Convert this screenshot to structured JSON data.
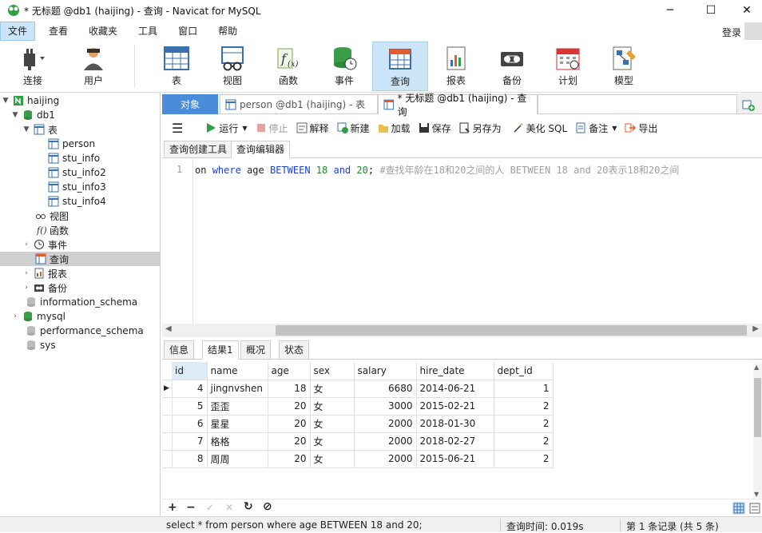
{
  "window": {
    "title": "* 无标题 @db1 (haijing) - 查询 - Navicat for MySQL",
    "minimize": "─",
    "maximize": "☐",
    "close": "✕"
  },
  "menu": {
    "items": [
      "文件",
      "查看",
      "收藏夹",
      "工具",
      "窗口",
      "帮助"
    ],
    "login": "登录"
  },
  "toolbar": {
    "items": [
      "连接",
      "用户",
      "表",
      "视图",
      "函数",
      "事件",
      "查询",
      "报表",
      "备份",
      "计划",
      "模型"
    ]
  },
  "nav": {
    "items": [
      {
        "label": "haijing"
      },
      {
        "label": "db1"
      },
      {
        "label": "表"
      },
      {
        "label": "person"
      },
      {
        "label": "stu_info"
      },
      {
        "label": "stu_info2"
      },
      {
        "label": "stu_info3"
      },
      {
        "label": "stu_info4"
      },
      {
        "label": "视图"
      },
      {
        "label": "函数"
      },
      {
        "label": "事件"
      },
      {
        "label": "查询"
      },
      {
        "label": "报表"
      },
      {
        "label": "备份"
      },
      {
        "label": "information_schema"
      },
      {
        "label": "mysql"
      },
      {
        "label": "performance_schema"
      },
      {
        "label": "sys"
      }
    ]
  },
  "tabs": {
    "objects": "对象",
    "person_tab": "person @db1 (haijing) - 表",
    "query_tab": "* 无标题 @db1 (haijing) - 查询"
  },
  "query_toolbar": {
    "run": "运行",
    "stop": "停止",
    "explain": "解释",
    "new": "新建",
    "load": "加载",
    "save": "保存",
    "save_as": "另存为",
    "beautify": "美化 SQL",
    "comment": "备注",
    "export": "导出"
  },
  "subtabs": {
    "builder": "查询创建工具",
    "editor": "查询编辑器"
  },
  "editor": {
    "line_no": "1",
    "code": {
      "frag": "on",
      "kw1": "where",
      "col": "age",
      "kw2": "BETWEEN",
      "n1": "18",
      "kw3": "and",
      "n2": "20",
      "semi": ";",
      "comment": "#查找年龄在18和20之间的人 BETWEEN 18 and 20表示18和20之间"
    }
  },
  "result_tabs": [
    "信息",
    "结果1",
    "概况",
    "状态"
  ],
  "result": {
    "columns": [
      "id",
      "name",
      "age",
      "sex",
      "salary",
      "hire_date",
      "dept_id"
    ],
    "rows": [
      [
        "4",
        "jingnvshen",
        "18",
        "女",
        "6680",
        "2014-06-21",
        "1"
      ],
      [
        "5",
        "歪歪",
        "20",
        "女",
        "3000",
        "2015-02-21",
        "2"
      ],
      [
        "6",
        "星星",
        "20",
        "女",
        "2000",
        "2018-01-30",
        "2"
      ],
      [
        "7",
        "格格",
        "20",
        "女",
        "2000",
        "2018-02-27",
        "2"
      ],
      [
        "8",
        "周周",
        "20",
        "女",
        "2000",
        "2015-06-21",
        "2"
      ]
    ]
  },
  "grid_toolbar": {
    "add": "+",
    "remove": "−",
    "apply": "✓",
    "discard": "✕",
    "refresh": "↻",
    "stop": "⊘"
  },
  "status": {
    "sql": "select * from person where age BETWEEN 18 and 20;",
    "time": "查询时间: 0.019s",
    "records": "第 1 条记录 (共 5 条)"
  },
  "colors": {
    "accent": "#4a8cd8",
    "selection": "#cce4f7",
    "keyword": "#1a3fe0",
    "number": "#1c8a2a",
    "comment": "#a0a0a0"
  }
}
